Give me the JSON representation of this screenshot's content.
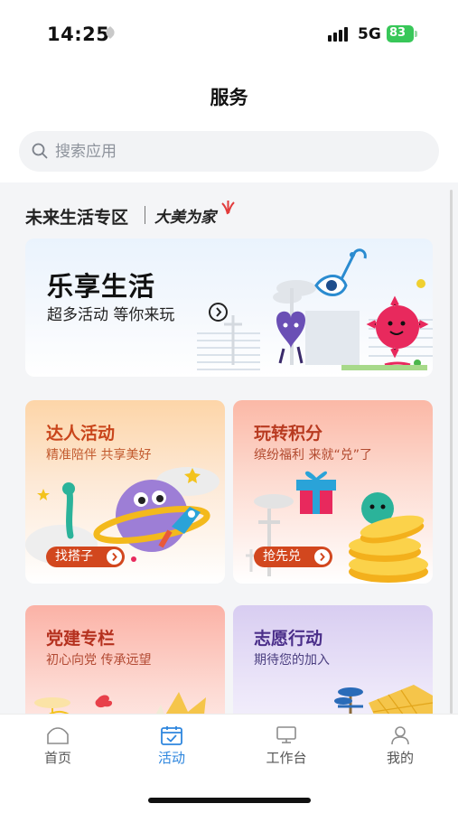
{
  "status_bar": {
    "time": "14:25",
    "network": "5G",
    "battery": "83"
  },
  "header": {
    "title": "服务"
  },
  "search": {
    "placeholder": "搜索应用",
    "value": ""
  },
  "zone": {
    "title": "未来生活专区",
    "logo_text": "大美为家"
  },
  "banner": {
    "title": "乐享生活",
    "subtitle": "超多活动 等你来玩"
  },
  "cards": [
    {
      "title": "达人活动",
      "subtitle": "精准陪伴 共享美好",
      "button": "找搭子"
    },
    {
      "title": "玩转积分",
      "subtitle": "缤纷福利 来就“兑”了",
      "button": "抢先兑"
    },
    {
      "title": "党建专栏",
      "subtitle": "初心向党 传承远望"
    },
    {
      "title": "志愿行动",
      "subtitle": "期待您的加入"
    }
  ],
  "tab_bar": {
    "tabs": [
      {
        "label": "首页",
        "icon": "home-icon",
        "active": false
      },
      {
        "label": "活动",
        "icon": "calendar-check-icon",
        "active": true
      },
      {
        "label": "工作台",
        "icon": "monitor-icon",
        "active": false
      },
      {
        "label": "我的",
        "icon": "user-icon",
        "active": false
      }
    ]
  },
  "colors": {
    "accent": "#2e86de",
    "button": "#d2471e",
    "battery": "#38c759"
  }
}
